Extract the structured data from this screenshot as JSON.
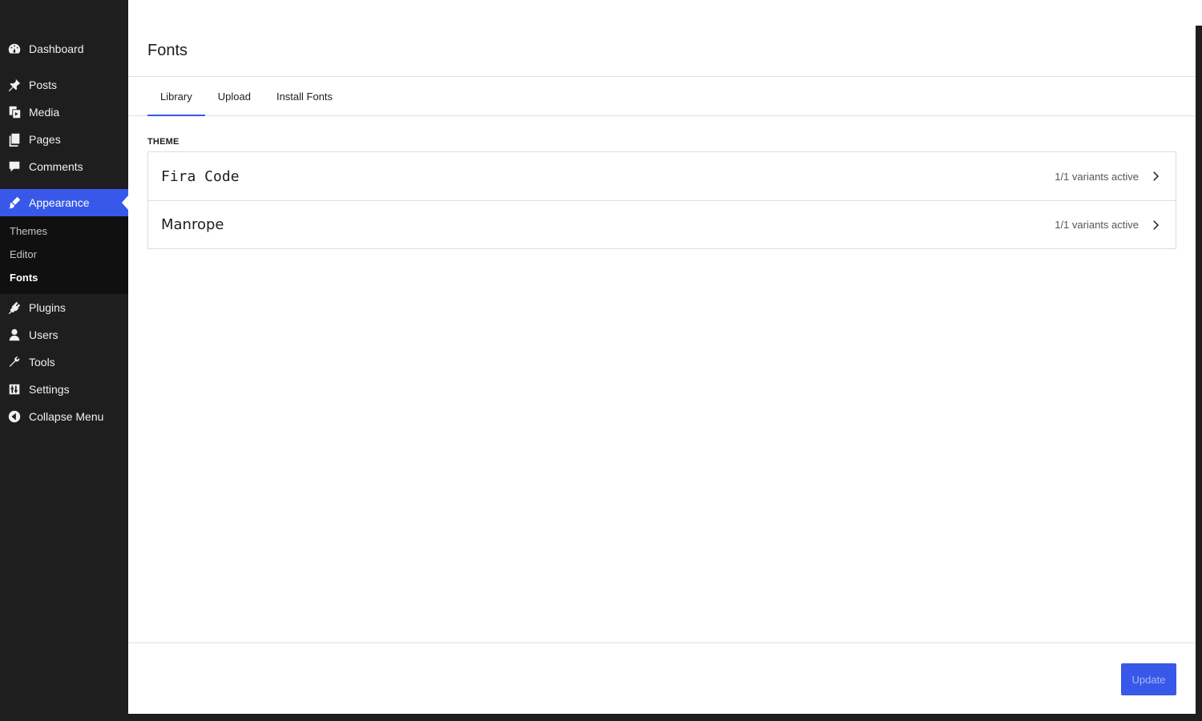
{
  "sidebar": {
    "items": [
      {
        "label": "Dashboard",
        "icon": "dashboard-icon"
      },
      {
        "label": "Posts",
        "icon": "pin-icon"
      },
      {
        "label": "Media",
        "icon": "media-icon"
      },
      {
        "label": "Pages",
        "icon": "pages-icon"
      },
      {
        "label": "Comments",
        "icon": "comment-icon"
      },
      {
        "label": "Appearance",
        "icon": "brush-icon"
      },
      {
        "label": "Plugins",
        "icon": "plugin-icon"
      },
      {
        "label": "Users",
        "icon": "user-icon"
      },
      {
        "label": "Tools",
        "icon": "wrench-icon"
      },
      {
        "label": "Settings",
        "icon": "settings-icon"
      },
      {
        "label": "Collapse Menu",
        "icon": "collapse-icon"
      }
    ],
    "submenu": [
      {
        "label": "Themes"
      },
      {
        "label": "Editor"
      },
      {
        "label": "Fonts",
        "current": true
      }
    ]
  },
  "panel": {
    "title": "Fonts",
    "tabs": [
      {
        "label": "Library",
        "active": true
      },
      {
        "label": "Upload"
      },
      {
        "label": "Install Fonts"
      }
    ],
    "section_label": "THEME",
    "fonts": [
      {
        "name": "Fira Code",
        "variants": "1/1 variants active"
      },
      {
        "name": "Manrope",
        "variants": "1/1 variants active"
      }
    ],
    "update_label": "Update"
  },
  "colors": {
    "accent": "#3858e9",
    "sidebar_bg": "#1e1e1e"
  }
}
